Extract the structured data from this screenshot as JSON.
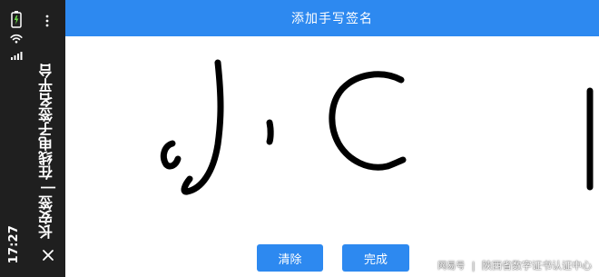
{
  "status_bar": {
    "time": "17:27",
    "battery_icon": "battery-charging-icon",
    "wifi_icon": "wifi-icon",
    "signal_icon": "signal-icon"
  },
  "left_bar": {
    "title": "长安签 | 在线电子签名平台",
    "more_icon": "more-vertical-icon",
    "close_icon": "close-icon"
  },
  "header": {
    "title": "添加手写签名"
  },
  "actions": {
    "clear_label": "清除",
    "done_label": "完成"
  },
  "watermark": {
    "brand": "网易号",
    "source": "陕西省数字证书认证中心"
  },
  "colors": {
    "primary": "#2d89f0",
    "left_bar": "#1f1f1f",
    "ink": "#000000",
    "background": "#ffffff"
  }
}
